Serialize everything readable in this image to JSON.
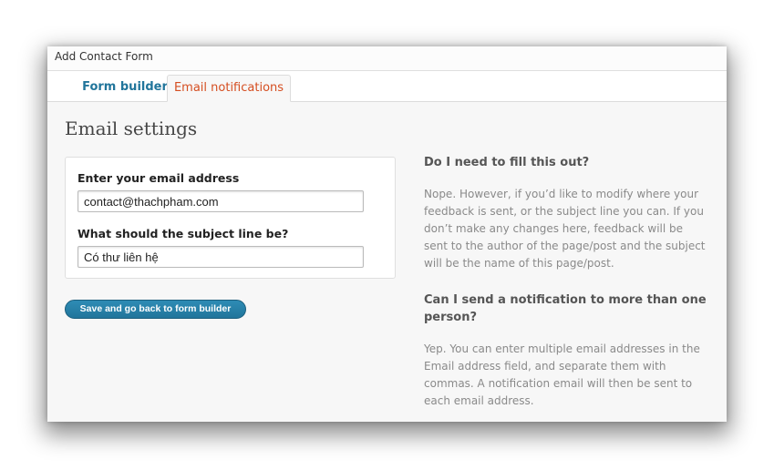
{
  "dialog": {
    "title": "Add Contact Form",
    "tabs": [
      {
        "label": "Form builder",
        "active": false
      },
      {
        "label": "Email notifications",
        "active": true
      }
    ]
  },
  "settings": {
    "heading": "Email settings",
    "email_label": "Enter your email address",
    "email_value": "contact@thachpham.com",
    "subject_label": "What should the subject line be?",
    "subject_value": "Có thư liên hệ",
    "save_label": "Save and go back to form builder"
  },
  "help": [
    {
      "question": "Do I need to fill this out?",
      "answer": "Nope. However, if you’d like to modify where your feedback is sent, or the subject line you can. If you don’t make any changes here, feedback will be sent to the author of the page/post and the subject will be the name of this page/post."
    },
    {
      "question": "Can I send a notification to more than one person?",
      "answer": "Yep. You can enter multiple email addresses in the Email address field, and separate them with commas. A notification email will then be sent to each email address."
    }
  ],
  "colors": {
    "link": "#21759b",
    "active_tab_text": "#d54e21",
    "button": "#21759b"
  }
}
